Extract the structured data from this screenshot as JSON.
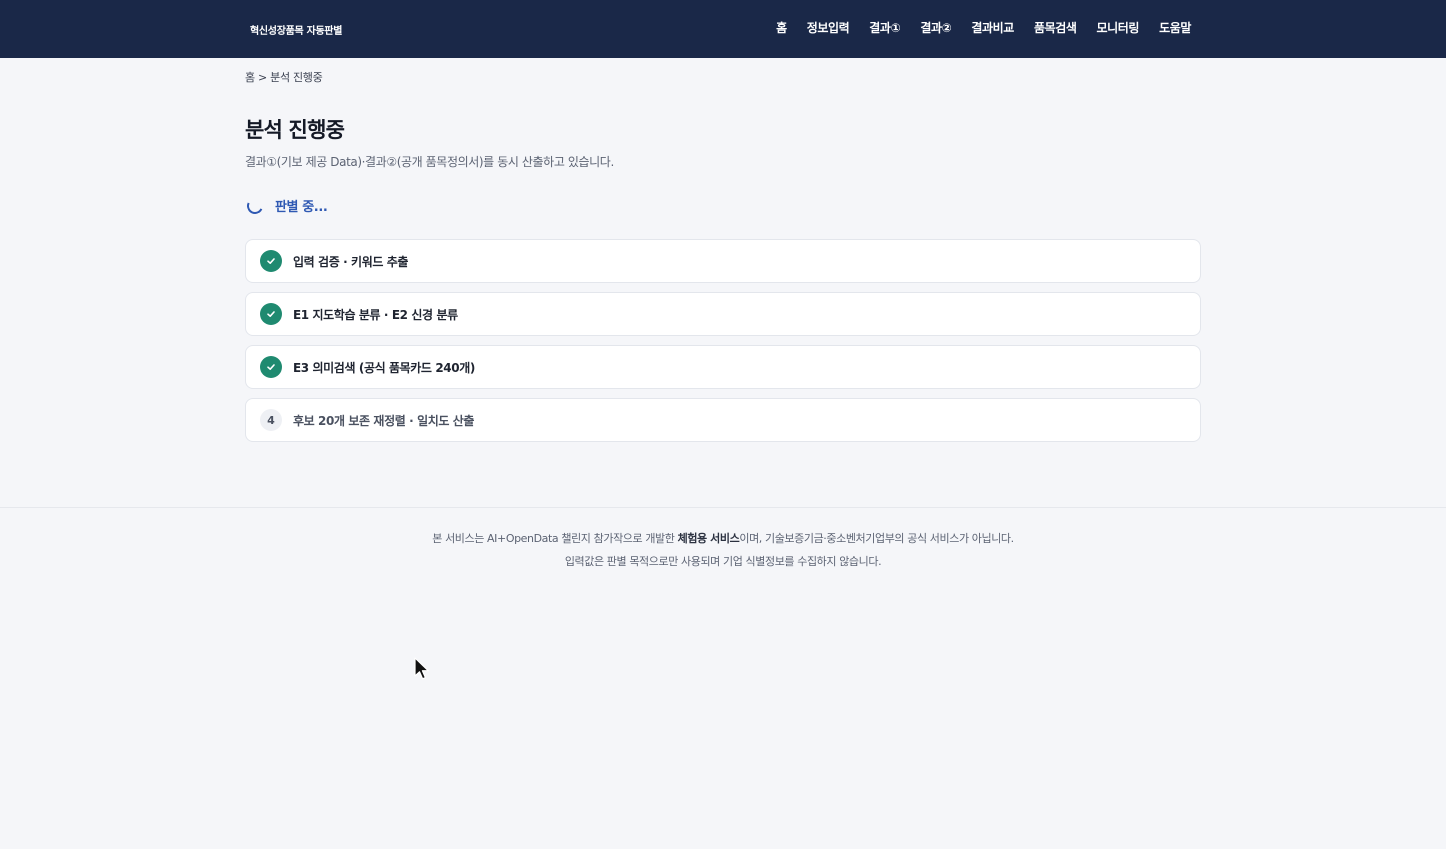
{
  "header": {
    "brand": "혁신성장품목 자동판별",
    "nav": [
      {
        "label": "홈"
      },
      {
        "label": "정보입력"
      },
      {
        "label": "결과①"
      },
      {
        "label": "결과②"
      },
      {
        "label": "결과비교"
      },
      {
        "label": "품목검색"
      },
      {
        "label": "모니터링"
      },
      {
        "label": "도움말"
      }
    ]
  },
  "breadcrumb": "홈 > 분석 진행중",
  "page": {
    "title": "분석 진행중",
    "subtitle": "결과①(기보 제공 Data)·결과②(공개 품목정의서)를 동시 산출하고 있습니다."
  },
  "status": {
    "text": "판별 중..."
  },
  "steps": [
    {
      "label": "입력 검증 · 키워드 추출",
      "state": "done",
      "icon": "check-icon"
    },
    {
      "label": "E1 지도학습 분류 · E2 신경 분류",
      "state": "done",
      "icon": "check-icon"
    },
    {
      "label": "E3 의미검색 (공식 품목카드 240개)",
      "state": "done",
      "icon": "check-icon"
    },
    {
      "label": "후보 20개 보존 재정렬 · 일치도 산출",
      "state": "pending",
      "number": "4"
    }
  ],
  "footer": {
    "line1_pre": "본 서비스는 AI+OpenData 챌린지 참가작으로 개발한 ",
    "line1_bold": "체험용 서비스",
    "line1_post": "이며, 기술보증기금·중소벤처기업부의 공식 서비스가 아닙니다.",
    "line2": "입력값은 판별 목적으로만 사용되며 기업 식별정보를 수집하지 않습니다."
  },
  "colors": {
    "header_bg": "#1a2848",
    "accent": "#2f59b3",
    "done": "#1f8a70"
  }
}
